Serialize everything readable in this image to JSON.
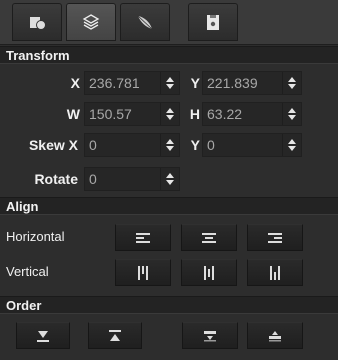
{
  "tabs": [
    {
      "icon": "fill-shape-icon"
    },
    {
      "icon": "layers-icon",
      "active": true
    },
    {
      "icon": "feather-icon"
    },
    {
      "icon": "document-icon"
    }
  ],
  "transform": {
    "title": "Transform",
    "x_label": "X",
    "x_value": "236.781",
    "y_label": "Y",
    "y_value": "221.839",
    "w_label": "W",
    "w_value": "150.57",
    "h_label": "H",
    "h_value": "63.22",
    "skew_x_label": "Skew X",
    "skew_x_value": "0",
    "skew_y_label": "Y",
    "skew_y_value": "0",
    "rotate_label": "Rotate",
    "rotate_value": "0"
  },
  "align": {
    "title": "Align",
    "horizontal_label": "Horizontal",
    "vertical_label": "Vertical"
  },
  "order": {
    "title": "Order"
  },
  "colors": {
    "panel_bg": "#2d2d2d",
    "header_bg": "#232323",
    "field_text": "#a8a8a8",
    "label_text": "#f0f0f0"
  }
}
